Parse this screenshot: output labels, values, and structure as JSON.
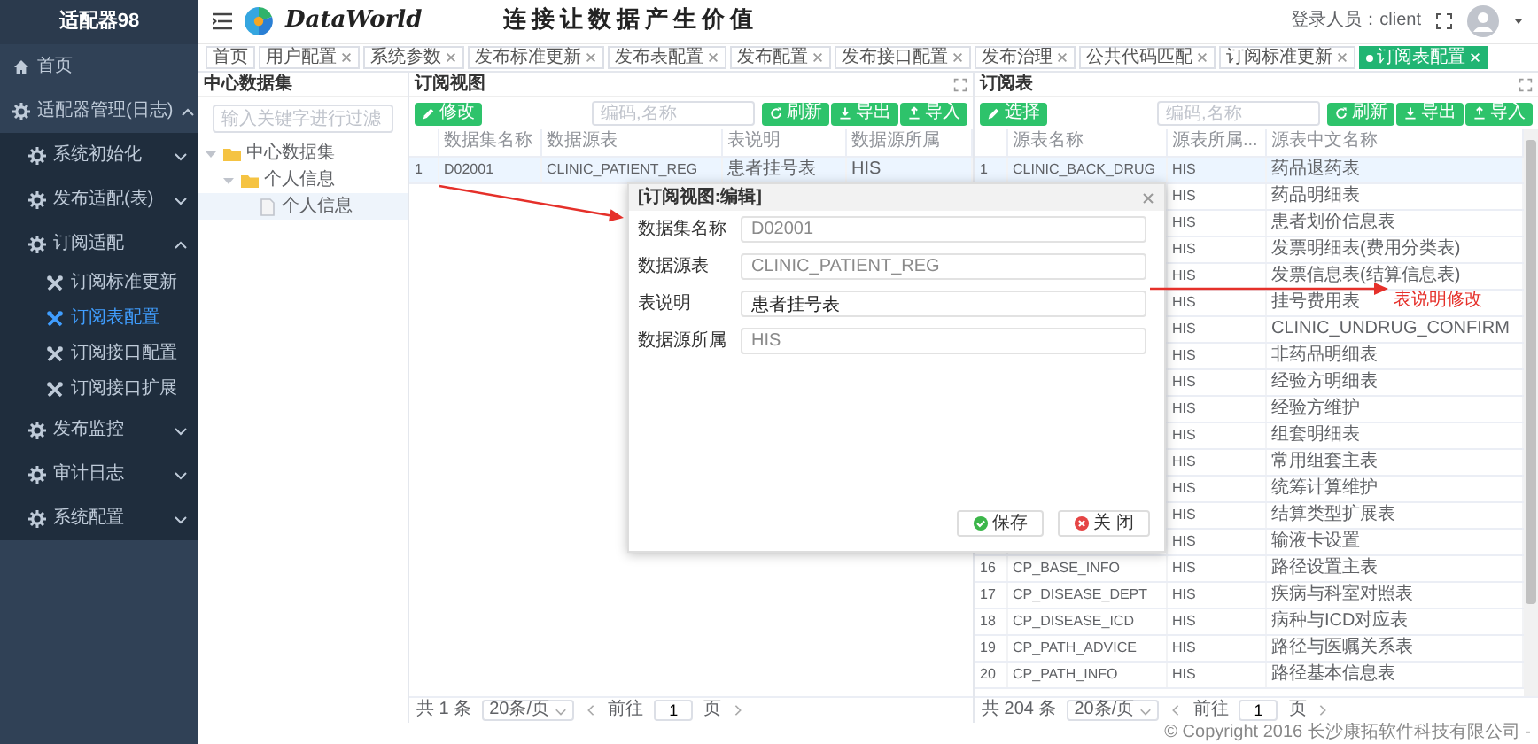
{
  "sidebar": {
    "title": "适配器98",
    "items": [
      {
        "label": "首页",
        "kind": "home",
        "selected": false
      },
      {
        "label": "适配器管理(日志)",
        "kind": "group",
        "expanded": true,
        "children": [
          {
            "label": "系统初始化",
            "kind": "group",
            "expanded": false
          },
          {
            "label": "发布适配(表)",
            "kind": "group",
            "expanded": false
          },
          {
            "label": "订阅适配",
            "kind": "group",
            "expanded": true,
            "children": [
              {
                "label": "订阅标准更新",
                "kind": "leaf",
                "selected": false
              },
              {
                "label": "订阅表配置",
                "kind": "leaf",
                "selected": true
              },
              {
                "label": "订阅接口配置",
                "kind": "leaf",
                "selected": false
              },
              {
                "label": "订阅接口扩展",
                "kind": "leaf",
                "selected": false
              }
            ]
          },
          {
            "label": "发布监控",
            "kind": "group",
            "expanded": false
          },
          {
            "label": "审计日志",
            "kind": "group",
            "expanded": false
          },
          {
            "label": "系统配置",
            "kind": "group",
            "expanded": false
          }
        ]
      }
    ]
  },
  "header": {
    "brand": "DataWorld",
    "slogan": "连接让数据产生价值",
    "user": "登录人员：client"
  },
  "tabs": [
    {
      "label": "首页",
      "closable": false,
      "selected": false
    },
    {
      "label": "用户配置",
      "closable": true,
      "selected": false
    },
    {
      "label": "系统参数",
      "closable": true,
      "selected": false
    },
    {
      "label": "发布标准更新",
      "closable": true,
      "selected": false
    },
    {
      "label": "发布表配置",
      "closable": true,
      "selected": false
    },
    {
      "label": "发布配置",
      "closable": true,
      "selected": false
    },
    {
      "label": "发布接口配置",
      "closable": true,
      "selected": false
    },
    {
      "label": "发布治理",
      "closable": true,
      "selected": false
    },
    {
      "label": "公共代码匹配",
      "closable": true,
      "selected": false
    },
    {
      "label": "订阅标准更新",
      "closable": true,
      "selected": false
    },
    {
      "label": "订阅表配置",
      "closable": true,
      "selected": true
    }
  ],
  "tree_panel": {
    "title": "中心数据集",
    "filter": {
      "placeholder": "输入关键字进行过滤"
    },
    "nodes": [
      {
        "label": "中心数据集",
        "kind": "folder",
        "expanded": true,
        "selected": false,
        "children": [
          {
            "label": "个人信息",
            "kind": "folder",
            "expanded": true,
            "selected": false,
            "children": [
              {
                "label": "个人信息",
                "kind": "file",
                "selected": true
              }
            ]
          }
        ]
      }
    ]
  },
  "view_panel": {
    "title": "订阅视图",
    "action_button": "修改",
    "search": {
      "placeholder": "编码,名称"
    },
    "tools": [
      {
        "label": "刷新",
        "kind": "refresh"
      },
      {
        "label": "导出",
        "kind": "export"
      },
      {
        "label": "导入",
        "kind": "import"
      }
    ],
    "columns": [
      "数据集名称",
      "数据源表",
      "表说明",
      "数据源所属"
    ],
    "rows": [
      {
        "index": "1",
        "cells": [
          "D02001",
          "CLINIC_PATIENT_REG",
          "患者挂号表",
          "HIS"
        ],
        "selected": true
      }
    ],
    "pager": {
      "total": "共 1 条",
      "page_size": "20条/页",
      "goto": "前往",
      "page": "1",
      "page_unit": "页"
    }
  },
  "table_panel": {
    "title": "订阅表",
    "action_button": "选择",
    "search": {
      "placeholder": "编码,名称"
    },
    "tools": [
      {
        "label": "刷新",
        "kind": "refresh"
      },
      {
        "label": "导出",
        "kind": "export"
      },
      {
        "label": "导入",
        "kind": "import"
      }
    ],
    "columns": [
      "源表名称",
      "源表所属...",
      "源表中文名称"
    ],
    "rows": [
      {
        "index": "1",
        "name": "CLINIC_BACK_DRUG",
        "source": "HIS",
        "cn_name": "药品退药表",
        "selected": true
      },
      {
        "source": "HIS",
        "cn_name": "药品明细表",
        "selected": false
      },
      {
        "source": "HIS",
        "cn_name": "患者划价信息表",
        "selected": false
      },
      {
        "source": "HIS",
        "cn_name": "发票明细表(费用分类表)",
        "selected": false
      },
      {
        "source": "HIS",
        "cn_name": "发票信息表(结算信息表)",
        "selected": false
      },
      {
        "source": "HIS",
        "cn_name": "挂号费用表",
        "selected": false
      },
      {
        "source": "HIS",
        "cn_name": "CLINIC_UNDRUG_CONFIRM",
        "selected": false
      },
      {
        "source": "HIS",
        "cn_name": "非药品明细表",
        "selected": false
      },
      {
        "source": "HIS",
        "cn_name": "经验方明细表",
        "selected": false
      },
      {
        "source": "HIS",
        "cn_name": "经验方维护",
        "selected": false
      },
      {
        "source": "HIS",
        "cn_name": "组套明细表",
        "selected": false
      },
      {
        "source": "HIS",
        "cn_name": "常用组套主表",
        "selected": false
      },
      {
        "source": "HIS",
        "cn_name": "统筹计算维护",
        "selected": false
      },
      {
        "source": "HIS",
        "cn_name": "结算类型扩展表",
        "selected": false
      },
      {
        "source": "HIS",
        "cn_name": "输液卡设置",
        "selected": false
      },
      {
        "index": "16",
        "name": "CP_BASE_INFO",
        "source": "HIS",
        "cn_name": "路径设置主表",
        "selected": false
      },
      {
        "index": "17",
        "name": "CP_DISEASE_DEPT",
        "source": "HIS",
        "cn_name": "疾病与科室对照表",
        "selected": false
      },
      {
        "index": "18",
        "name": "CP_DISEASE_ICD",
        "source": "HIS",
        "cn_name": "病种与ICD对应表",
        "selected": false
      },
      {
        "index": "19",
        "name": "CP_PATH_ADVICE",
        "source": "HIS",
        "cn_name": "路径与医嘱关系表",
        "selected": false
      },
      {
        "index": "20",
        "name": "CP_PATH_INFO",
        "source": "HIS",
        "cn_name": "路径基本信息表",
        "selected": false
      }
    ],
    "pager": {
      "total": "共 204 条",
      "page_size": "20条/页",
      "goto": "前往",
      "page": "1",
      "page_unit": "页"
    }
  },
  "modal": {
    "title": "[订阅视图:编辑]",
    "fields": [
      {
        "label": "数据集名称",
        "value": "D02001",
        "editable": false
      },
      {
        "label": "数据源表",
        "value": "CLINIC_PATIENT_REG",
        "editable": false
      },
      {
        "label": "表说明",
        "value": "患者挂号表",
        "editable": true
      },
      {
        "label": "数据源所属",
        "value": "HIS",
        "editable": false
      }
    ],
    "buttons": [
      {
        "label": "保存",
        "kind": "save"
      },
      {
        "label": "关 闭",
        "kind": "close"
      }
    ]
  },
  "annotation": {
    "text": "表说明修改"
  },
  "footer": {
    "copyright": "© Copyright 2016 长沙康拓软件科技有限公司 -"
  }
}
